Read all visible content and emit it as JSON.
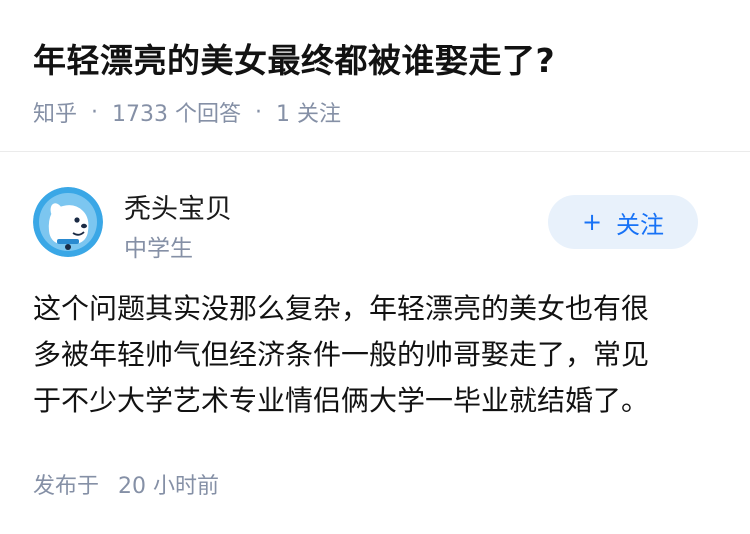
{
  "question": {
    "title": "年轻漂亮的美女最终都被谁娶走了?",
    "source": "知乎",
    "answer_count": "1733 个回答",
    "follower_count": "1 关注"
  },
  "author": {
    "name": "秃头宝贝",
    "badge": "中学生",
    "avatar_icon": "cartoon-dog-avatar-icon",
    "follow_label": "关注",
    "follow_icon": "plus-icon"
  },
  "answer": {
    "lines": [
      "这个问题其实没那么复杂，年轻漂亮的美女也有很",
      "多被年轻帅气但经济条件一般的帅哥娶走了，常见",
      "于不少大学艺术专业情侣俩大学一毕业就结婚了。"
    ],
    "published_label": "发布于",
    "published_time": "20 小时前"
  },
  "colors": {
    "accent": "#1772f6",
    "accent_bg": "#e8f1fb",
    "meta_gray": "#8590a6",
    "avatar_bg": "#3aa7e6"
  }
}
